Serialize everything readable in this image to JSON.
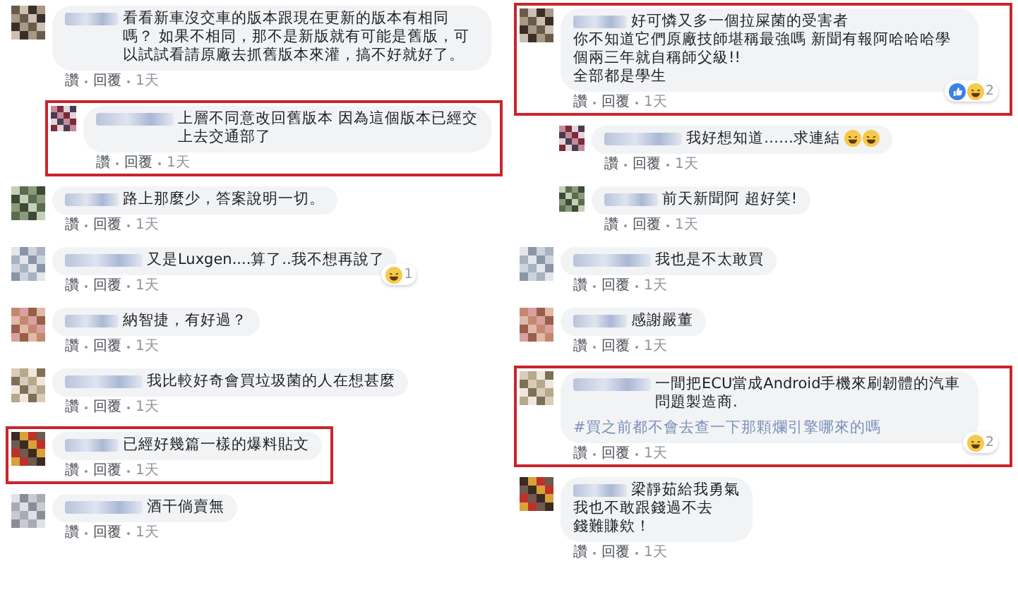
{
  "columns": [
    {
      "comments": [
        {
          "reply": false,
          "highlighted": false,
          "lines": [
            "看看新車沒交車的版本跟現在更新的版本有相同嗎？ 如果不相同，那不是新版就有可能是舊版，可以試試看請原廠去抓舊版本來灌，搞不好就好了。"
          ],
          "actions": [
            {
              "kind": "link",
              "label": "讚"
            },
            {
              "kind": "link",
              "label": "回覆"
            },
            {
              "kind": "time",
              "label": "1天"
            }
          ]
        },
        {
          "reply": true,
          "highlighted": true,
          "lines": [
            "上層不同意改回舊版本 因為這個版本已經交上去交通部了"
          ],
          "actions": [
            {
              "kind": "link",
              "label": "讚"
            },
            {
              "kind": "link",
              "label": "回覆"
            },
            {
              "kind": "time",
              "label": "1天"
            }
          ]
        },
        {
          "reply": false,
          "highlighted": false,
          "lines": [
            "路上那麼少，答案說明一切。"
          ],
          "actions": [
            {
              "kind": "link",
              "label": "讚"
            },
            {
              "kind": "link",
              "label": "回覆"
            },
            {
              "kind": "time",
              "label": "1天"
            }
          ]
        },
        {
          "reply": false,
          "highlighted": false,
          "lines": [
            "又是Luxgen....算了..我不想再說了"
          ],
          "reactions": {
            "icons": [
              {
                "kind": "haha"
              }
            ],
            "count": "1"
          },
          "actions": [
            {
              "kind": "link",
              "label": "讚"
            },
            {
              "kind": "link",
              "label": "回覆"
            },
            {
              "kind": "time",
              "label": "1天"
            }
          ]
        },
        {
          "reply": false,
          "highlighted": false,
          "lines": [
            "納智捷，有好過？"
          ],
          "actions": [
            {
              "kind": "link",
              "label": "讚"
            },
            {
              "kind": "link",
              "label": "回覆"
            },
            {
              "kind": "time",
              "label": "1天"
            }
          ]
        },
        {
          "reply": false,
          "highlighted": false,
          "lines": [
            "我比較好奇會買垃圾菌的人在想甚麼"
          ],
          "actions": [
            {
              "kind": "link",
              "label": "讚"
            },
            {
              "kind": "link",
              "label": "回覆"
            },
            {
              "kind": "time",
              "label": "1天"
            }
          ]
        },
        {
          "reply": false,
          "highlighted": true,
          "lines": [
            "已經好幾篇一樣的爆料貼文"
          ],
          "actions": [
            {
              "kind": "link",
              "label": "讚"
            },
            {
              "kind": "link",
              "label": "回覆"
            },
            {
              "kind": "time",
              "label": "1天"
            }
          ]
        },
        {
          "reply": false,
          "highlighted": false,
          "lines": [
            "酒干倘賣無"
          ],
          "actions": [
            {
              "kind": "link",
              "label": "讚"
            },
            {
              "kind": "link",
              "label": "回覆"
            },
            {
              "kind": "time",
              "label": "1天"
            }
          ]
        }
      ]
    },
    {
      "comments": [
        {
          "reply": false,
          "highlighted": true,
          "lines": [
            "好可憐又多一個拉屎菌的受害者",
            "你不知道它們原廠技師堪稱最強嗎 新聞有報阿哈哈哈學個兩三年就自稱師父級!!",
            "全部都是學生"
          ],
          "reactions": {
            "icons": [
              {
                "kind": "like"
              },
              {
                "kind": "haha"
              }
            ],
            "count": "2"
          },
          "actions": [
            {
              "kind": "link",
              "label": "讚"
            },
            {
              "kind": "link",
              "label": "回覆"
            },
            {
              "kind": "time",
              "label": "1天"
            }
          ]
        },
        {
          "reply": true,
          "highlighted": false,
          "lines": [
            "我好想知道……求連結"
          ],
          "inline_icons": [
            {
              "kind": "laugh"
            },
            {
              "kind": "laugh"
            }
          ],
          "actions": [
            {
              "kind": "link",
              "label": "讚"
            },
            {
              "kind": "link",
              "label": "回覆"
            },
            {
              "kind": "time",
              "label": "1天"
            }
          ]
        },
        {
          "reply": true,
          "highlighted": false,
          "lines": [
            "前天新聞阿 超好笑!"
          ],
          "actions": [
            {
              "kind": "link",
              "label": "讚"
            },
            {
              "kind": "link",
              "label": "回覆"
            },
            {
              "kind": "time",
              "label": "1天"
            }
          ]
        },
        {
          "reply": false,
          "highlighted": false,
          "lines": [
            "我也是不太敢買"
          ],
          "actions": [
            {
              "kind": "link",
              "label": "讚"
            },
            {
              "kind": "link",
              "label": "回覆"
            },
            {
              "kind": "time",
              "label": "1天"
            }
          ]
        },
        {
          "reply": false,
          "highlighted": false,
          "lines": [
            "感謝嚴董"
          ],
          "actions": [
            {
              "kind": "link",
              "label": "讚"
            },
            {
              "kind": "link",
              "label": "回覆"
            },
            {
              "kind": "time",
              "label": "1天"
            }
          ]
        },
        {
          "reply": false,
          "highlighted": true,
          "lines": [
            "一間把ECU當成Android手機來刷韌體的汽車問題製造商."
          ],
          "hashtag": "#買之前都不會去查一下那顆爛引擎哪來的嗎",
          "reactions": {
            "icons": [
              {
                "kind": "haha"
              }
            ],
            "count": "2"
          },
          "actions": [
            {
              "kind": "link",
              "label": "讚"
            },
            {
              "kind": "link",
              "label": "回覆"
            },
            {
              "kind": "time",
              "label": "1天"
            }
          ]
        },
        {
          "reply": false,
          "highlighted": false,
          "lines": [
            "梁靜茹給我勇氣",
            "我也不敢跟錢過不去",
            "錢難賺欸！"
          ],
          "actions": [
            {
              "kind": "link",
              "label": "讚"
            },
            {
              "kind": "link",
              "label": "回覆"
            },
            {
              "kind": "time",
              "label": "1天"
            }
          ]
        }
      ]
    }
  ]
}
